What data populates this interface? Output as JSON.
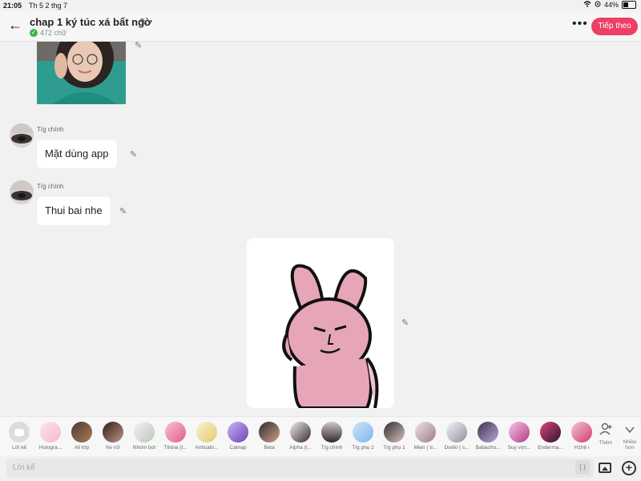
{
  "status": {
    "time": "21:05",
    "date": "Th 5 2 thg 7",
    "battery": "44%"
  },
  "header": {
    "title": "chap 1 ký túc xá bất ngờ",
    "word_count": "472 chữ",
    "next_label": "Tiếp theo"
  },
  "messages": [
    {
      "speaker": "T/g chính",
      "text": "Mặt dùng app"
    },
    {
      "speaker": "T/g chính",
      "text": "Thui bai nhe"
    }
  ],
  "characters": [
    {
      "name": "Lời kể"
    },
    {
      "name": "Hologra..."
    },
    {
      "name": "All lớp"
    },
    {
      "name": "Nv nữ"
    },
    {
      "name": "Nhóm bot"
    },
    {
      "name": "Tthina (t..."
    },
    {
      "name": "Anticatn..."
    },
    {
      "name": "Catnap"
    },
    {
      "name": "Beta"
    },
    {
      "name": "Alpha (l..."
    },
    {
      "name": "T/g chính"
    },
    {
      "name": "T/g phụ 2"
    },
    {
      "name": "T/g phụ 1"
    },
    {
      "name": "Mien ( tr..."
    },
    {
      "name": "Doriki ( s..."
    },
    {
      "name": "Babacho..."
    },
    {
      "name": "Suy von..."
    },
    {
      "name": "Enderma..."
    },
    {
      "name": "H1hệ i"
    }
  ],
  "side": {
    "add_label": "Thêm",
    "more_label": "Nhiều hơn"
  },
  "input": {
    "placeholder": "Lời kể",
    "brace": "{ }"
  },
  "colors": {
    "accent": "#ee3f66",
    "check": "#39b54a",
    "background": "#f1f1f1"
  }
}
